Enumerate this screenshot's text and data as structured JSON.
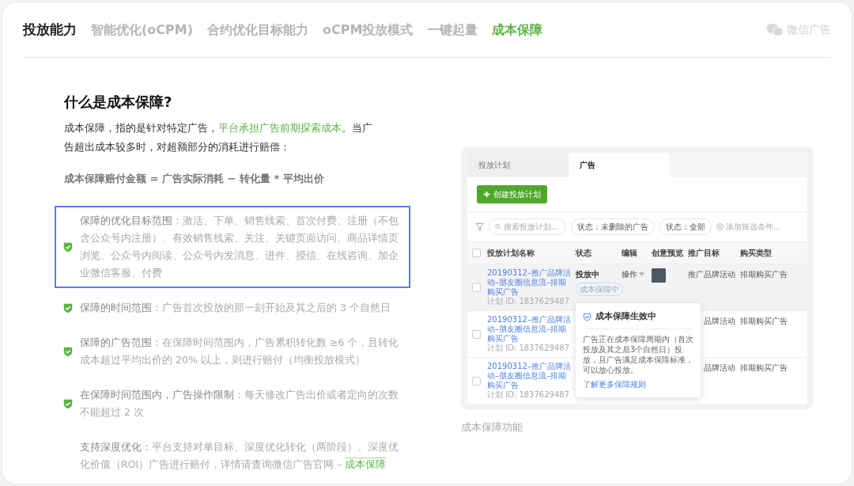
{
  "nav": {
    "section": "投放能力",
    "tabs": [
      {
        "label": "智能优化(oCPM)",
        "selected": false
      },
      {
        "label": "合约优化目标能力",
        "selected": false
      },
      {
        "label": "oCPM投放模式",
        "selected": false
      },
      {
        "label": "一键起量",
        "selected": false
      },
      {
        "label": "成本保障",
        "selected": true
      }
    ],
    "brand": "微信广告"
  },
  "article": {
    "title": "什么是成本保障?",
    "intro": [
      {
        "kind": "plain",
        "text": "成本保障，指的是针对特定广告，"
      },
      {
        "kind": "highlight",
        "text": "平台承担广告前期探索成本"
      },
      {
        "kind": "plain",
        "text": "。当广告超出成本较多时，对超额部分的消耗进行赔偿："
      }
    ],
    "formula": "成本保障赔付金额 = 广告实际消耗 − 转化量 * 平均出价",
    "items": [
      {
        "kind": "check",
        "selected": true,
        "label": "保障的优化目标范围",
        "text": "：激活、下单、销售线索、首次付费、注册（不包含公众号内注册）、有效销售线索、关注、关键页面访问、商品详情页浏览、公众号内阅读、公众号内发消息、进件、授信、在线咨询、加企业微信客服、付费"
      },
      {
        "kind": "check",
        "selected": false,
        "label": "保障的时间范围",
        "text": "：广告首次投放的那一刻开始及其之后的 3 个自然日"
      },
      {
        "kind": "check",
        "selected": false,
        "label": "保障的广告范围",
        "text": "：在保障时间范围内，广告累积转化数 ≥6 个，且转化成本超过平均出价的 20% 以上，则进行赔付（均衡投放模式）"
      },
      {
        "kind": "check",
        "selected": false,
        "label": "在保障时间范围内，广告操作限制",
        "text": "：每天修改广告出价或者定向的次数不能超过 2 次"
      },
      {
        "kind": "plain",
        "selected": false,
        "label": "支持深度优化：",
        "text": "平台支持对单目标、深度优化转化（两阶段）、深度优化价值（ROI）广告进行赔付，详情请查询微信广告官网 – ",
        "link": "成本保障"
      }
    ]
  },
  "screenshot": {
    "tabs": [
      {
        "label": "投放计划",
        "selected": false
      },
      {
        "label": "广告",
        "selected": true
      }
    ],
    "create_button": "创建投放计划",
    "search": {
      "placeholder": "搜索投放计划..."
    },
    "filters": [
      "状态：未删除的广告",
      "状态：全部"
    ],
    "add_filter": "添加筛选条件...",
    "select_all": {
      "checked": false
    },
    "columns": [
      "投放计划名称",
      "状态",
      "编辑",
      "创意预览",
      "推广目标",
      "购买类型"
    ],
    "rows": [
      {
        "selected": true,
        "name": "20190312–推广品牌活动–朋友圈信息流–排期购买广告",
        "plan_id": "计划 ID: 1837629487",
        "status": "投放中",
        "badge": "成本保障中",
        "edit": "操作",
        "preview": true,
        "target": "推广品牌活动",
        "purchase": "排期购买广告"
      },
      {
        "selected": false,
        "name": "20190312–推广品牌活动–朋友圈信息流–排期购买广告",
        "plan_id": "计划 ID: 1837629487",
        "target": "品牌活动",
        "purchase": "排期购买广告"
      },
      {
        "selected": false,
        "name": "20190312–推广品牌活动–朋友圈信息流–排期购买广告",
        "plan_id": "计划 ID: 1837629487",
        "target": "品牌活动",
        "purchase": "排期购买广告"
      }
    ],
    "popover": {
      "title": "成本保障生效中",
      "body": "广告正在成本保障周期内（首次投放及其之后3个自然日）投放，且广告满足成本保障标准，可以放心投放。",
      "link": "了解更多保障规则"
    }
  },
  "caption": "成本保障功能"
}
